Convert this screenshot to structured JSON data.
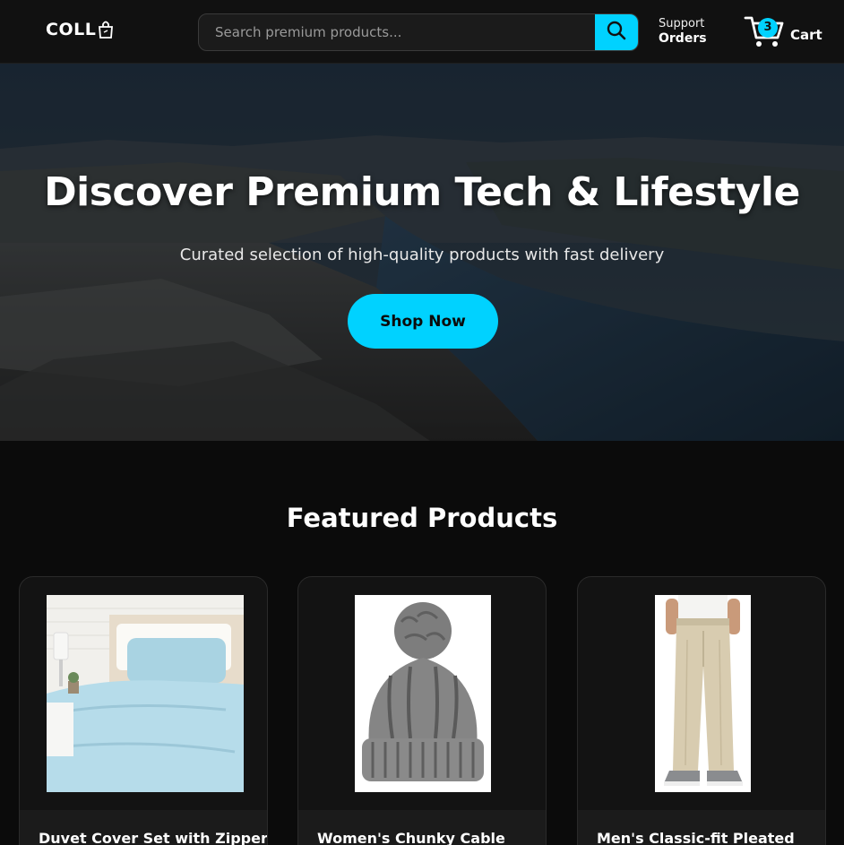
{
  "header": {
    "logo_text": "COLL",
    "search_placeholder": "Search premium products...",
    "support_label": "Support",
    "orders_label": "Orders",
    "cart_label": "Cart",
    "cart_count": "3",
    "accent_color": "#00d2ff"
  },
  "hero": {
    "title": "Discover Premium Tech & Lifestyle",
    "subtitle": "Curated selection of high-quality products with fast delivery",
    "cta_label": "Shop Now"
  },
  "featured": {
    "title": "Featured Products",
    "products": [
      {
        "title": "Duvet Cover Set with Zipper"
      },
      {
        "title": "Women's Chunky Cable"
      },
      {
        "title": "Men's Classic-fit Pleated"
      }
    ]
  }
}
